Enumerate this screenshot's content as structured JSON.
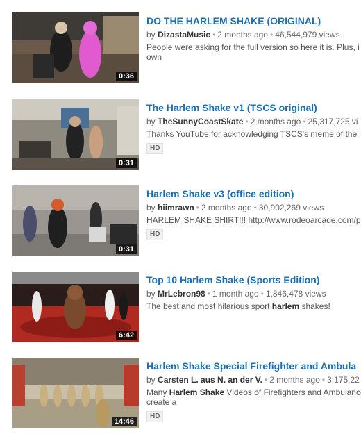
{
  "videos": [
    {
      "title": "DO THE HARLEM SHAKE (ORIGINAL)",
      "by": "by",
      "user": "DizastaMusic",
      "age": "2 months ago",
      "views": "46,544,979 views",
      "desc_line1": "People were asking for the full version so here it is. Plus, i",
      "desc_line2": "own",
      "duration": "0:36",
      "hd": ""
    },
    {
      "title": "The Harlem Shake v1 (TSCS original)",
      "by": "by",
      "user": "TheSunnyCoastSkate",
      "age": "2 months ago",
      "views": "25,317,725 vi",
      "desc_line1": "Thanks YouTube for acknowledging TSCS's meme of the",
      "desc_line2": "",
      "duration": "0:31",
      "hd": "HD"
    },
    {
      "title": "Harlem Shake v3 (office edition)",
      "by": "by",
      "user": "hiimrawn",
      "age": "2 months ago",
      "views": "30,902,269 views",
      "desc_line1": "HARLEM SHAKE SHIRT!!! http://www.rodeoarcade.com/pro",
      "desc_line2": "",
      "duration": "0:31",
      "hd": "HD"
    },
    {
      "title": "Top 10 Harlem Shake (Sports Edition)",
      "by": "by",
      "user": "MrLebron98",
      "age": "1 month ago",
      "views": "1,846,478 views",
      "desc_pre": "The best and most hilarious sport ",
      "desc_bold": "harlem",
      "desc_post": " shakes!",
      "duration": "6:42",
      "hd": ""
    },
    {
      "title": "Harlem Shake Special Firefighter and Ambula",
      "by": "by",
      "user": "Carsten L. aus N. an der V.",
      "age": "2 months ago",
      "views": "3,175,22",
      "desc_pre": "Many ",
      "desc_bold": "Harlem Shake",
      "desc_post": " Videos of Firefighters and Ambulance",
      "desc_line2": "create a",
      "duration": "14:46",
      "hd": "HD"
    }
  ],
  "colors": {
    "link": "#1b6fb3",
    "meta": "#666666",
    "duration_bg": "#000000"
  }
}
